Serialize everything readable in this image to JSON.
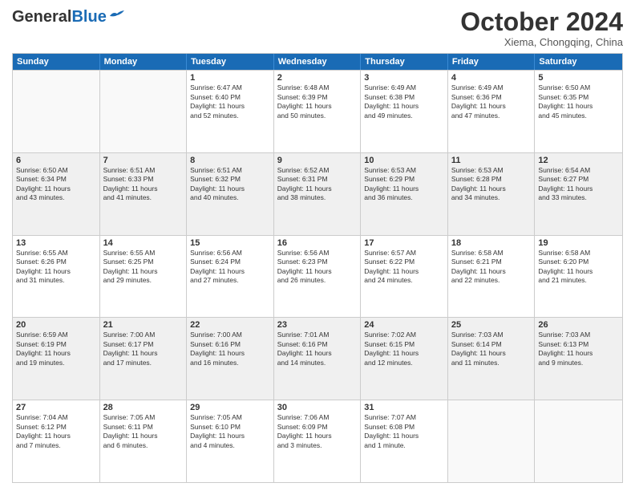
{
  "header": {
    "logo_general": "General",
    "logo_blue": "Blue",
    "month": "October 2024",
    "location": "Xiema, Chongqing, China"
  },
  "days_of_week": [
    "Sunday",
    "Monday",
    "Tuesday",
    "Wednesday",
    "Thursday",
    "Friday",
    "Saturday"
  ],
  "weeks": [
    [
      {
        "day": "",
        "info": ""
      },
      {
        "day": "",
        "info": ""
      },
      {
        "day": "1",
        "info": "Sunrise: 6:47 AM\nSunset: 6:40 PM\nDaylight: 11 hours\nand 52 minutes."
      },
      {
        "day": "2",
        "info": "Sunrise: 6:48 AM\nSunset: 6:39 PM\nDaylight: 11 hours\nand 50 minutes."
      },
      {
        "day": "3",
        "info": "Sunrise: 6:49 AM\nSunset: 6:38 PM\nDaylight: 11 hours\nand 49 minutes."
      },
      {
        "day": "4",
        "info": "Sunrise: 6:49 AM\nSunset: 6:36 PM\nDaylight: 11 hours\nand 47 minutes."
      },
      {
        "day": "5",
        "info": "Sunrise: 6:50 AM\nSunset: 6:35 PM\nDaylight: 11 hours\nand 45 minutes."
      }
    ],
    [
      {
        "day": "6",
        "info": "Sunrise: 6:50 AM\nSunset: 6:34 PM\nDaylight: 11 hours\nand 43 minutes."
      },
      {
        "day": "7",
        "info": "Sunrise: 6:51 AM\nSunset: 6:33 PM\nDaylight: 11 hours\nand 41 minutes."
      },
      {
        "day": "8",
        "info": "Sunrise: 6:51 AM\nSunset: 6:32 PM\nDaylight: 11 hours\nand 40 minutes."
      },
      {
        "day": "9",
        "info": "Sunrise: 6:52 AM\nSunset: 6:31 PM\nDaylight: 11 hours\nand 38 minutes."
      },
      {
        "day": "10",
        "info": "Sunrise: 6:53 AM\nSunset: 6:29 PM\nDaylight: 11 hours\nand 36 minutes."
      },
      {
        "day": "11",
        "info": "Sunrise: 6:53 AM\nSunset: 6:28 PM\nDaylight: 11 hours\nand 34 minutes."
      },
      {
        "day": "12",
        "info": "Sunrise: 6:54 AM\nSunset: 6:27 PM\nDaylight: 11 hours\nand 33 minutes."
      }
    ],
    [
      {
        "day": "13",
        "info": "Sunrise: 6:55 AM\nSunset: 6:26 PM\nDaylight: 11 hours\nand 31 minutes."
      },
      {
        "day": "14",
        "info": "Sunrise: 6:55 AM\nSunset: 6:25 PM\nDaylight: 11 hours\nand 29 minutes."
      },
      {
        "day": "15",
        "info": "Sunrise: 6:56 AM\nSunset: 6:24 PM\nDaylight: 11 hours\nand 27 minutes."
      },
      {
        "day": "16",
        "info": "Sunrise: 6:56 AM\nSunset: 6:23 PM\nDaylight: 11 hours\nand 26 minutes."
      },
      {
        "day": "17",
        "info": "Sunrise: 6:57 AM\nSunset: 6:22 PM\nDaylight: 11 hours\nand 24 minutes."
      },
      {
        "day": "18",
        "info": "Sunrise: 6:58 AM\nSunset: 6:21 PM\nDaylight: 11 hours\nand 22 minutes."
      },
      {
        "day": "19",
        "info": "Sunrise: 6:58 AM\nSunset: 6:20 PM\nDaylight: 11 hours\nand 21 minutes."
      }
    ],
    [
      {
        "day": "20",
        "info": "Sunrise: 6:59 AM\nSunset: 6:19 PM\nDaylight: 11 hours\nand 19 minutes."
      },
      {
        "day": "21",
        "info": "Sunrise: 7:00 AM\nSunset: 6:17 PM\nDaylight: 11 hours\nand 17 minutes."
      },
      {
        "day": "22",
        "info": "Sunrise: 7:00 AM\nSunset: 6:16 PM\nDaylight: 11 hours\nand 16 minutes."
      },
      {
        "day": "23",
        "info": "Sunrise: 7:01 AM\nSunset: 6:16 PM\nDaylight: 11 hours\nand 14 minutes."
      },
      {
        "day": "24",
        "info": "Sunrise: 7:02 AM\nSunset: 6:15 PM\nDaylight: 11 hours\nand 12 minutes."
      },
      {
        "day": "25",
        "info": "Sunrise: 7:03 AM\nSunset: 6:14 PM\nDaylight: 11 hours\nand 11 minutes."
      },
      {
        "day": "26",
        "info": "Sunrise: 7:03 AM\nSunset: 6:13 PM\nDaylight: 11 hours\nand 9 minutes."
      }
    ],
    [
      {
        "day": "27",
        "info": "Sunrise: 7:04 AM\nSunset: 6:12 PM\nDaylight: 11 hours\nand 7 minutes."
      },
      {
        "day": "28",
        "info": "Sunrise: 7:05 AM\nSunset: 6:11 PM\nDaylight: 11 hours\nand 6 minutes."
      },
      {
        "day": "29",
        "info": "Sunrise: 7:05 AM\nSunset: 6:10 PM\nDaylight: 11 hours\nand 4 minutes."
      },
      {
        "day": "30",
        "info": "Sunrise: 7:06 AM\nSunset: 6:09 PM\nDaylight: 11 hours\nand 3 minutes."
      },
      {
        "day": "31",
        "info": "Sunrise: 7:07 AM\nSunset: 6:08 PM\nDaylight: 11 hours\nand 1 minute."
      },
      {
        "day": "",
        "info": ""
      },
      {
        "day": "",
        "info": ""
      }
    ]
  ]
}
